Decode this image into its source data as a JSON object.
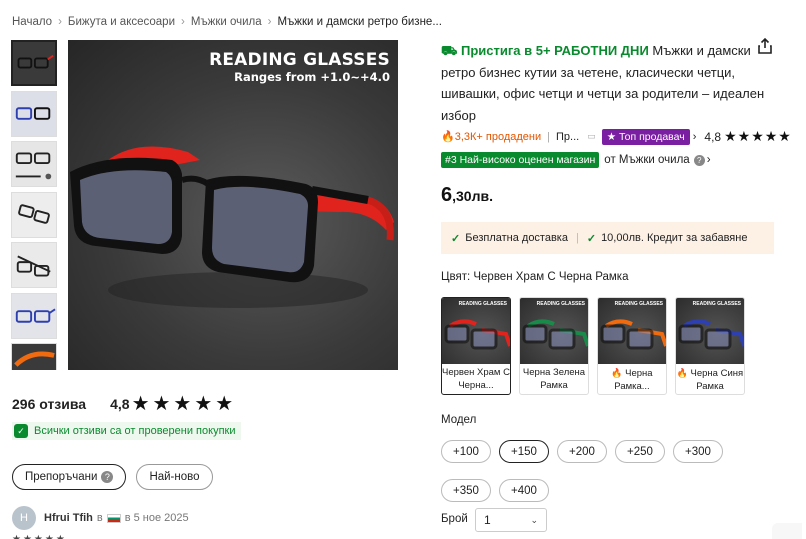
{
  "breadcrumb": [
    "Начало",
    "Бижута и аксесоари",
    "Мъжки очила",
    "Мъжки и дамски ретро бизне..."
  ],
  "hero": {
    "heading": "READING GLASSES",
    "subheading": "Ranges from +1.0~+4.0"
  },
  "reviews": {
    "count_label": "296 отзива",
    "rating": "4,8",
    "stars": "★★★★★",
    "verified_text": "Всички отзиви са от проверени покупки",
    "sort_recommended": "Препоръчани",
    "sort_newest": "Най-ново",
    "first_review": {
      "avatar_letter": "H",
      "name": "Hfrui Tfih",
      "in_word": "в",
      "date_text": "в 5 ное 2025",
      "stars": "★★★★★"
    }
  },
  "product": {
    "shipping_text": "Пристига в 5+ РАБОТНИ ДНИ",
    "title": "Мъжки и дамски ретро бизнес кутии за четене, класически четци, шивашки, офис четци и четци за родители – идеален избор",
    "sold": "3,3К+ продадени",
    "store_short": "Пр...",
    "top_seller": "Топ продавач",
    "rating": "4,8",
    "stars": "★★★★★",
    "rank_badge": "#3 Най-високо оценен магазин",
    "rank_category": "от Мъжки очила",
    "price_whole": "6",
    "price_rest": ",30лв.",
    "benefit_1": "Безплатна доставка",
    "benefit_2": "10,00лв. Кредит за забавяне",
    "color_label": "Цвят: Червен Храм С Черна Рамка",
    "color_options": [
      {
        "label": "Червен Храм С Черна...",
        "hot": false,
        "frame_color": "#111111",
        "temple_color": "#e0231d"
      },
      {
        "label": "Черна Зелена Рамка",
        "hot": false,
        "frame_color": "#111111",
        "temple_color": "#1a8a4a"
      },
      {
        "label": "Черна Рамка...",
        "hot": true,
        "frame_color": "#111111",
        "temple_color": "#f06a10"
      },
      {
        "label": "Черна Синя Рамка",
        "hot": true,
        "frame_color": "#111111",
        "temple_color": "#2e3fb0"
      }
    ],
    "swatch_text": "READING GLASSES",
    "model_label": "Модел",
    "models": [
      "+100",
      "+150",
      "+200",
      "+250",
      "+300",
      "+350",
      "+400"
    ],
    "selected_model": "+150",
    "qty_label": "Брой",
    "qty_value": "1"
  },
  "colors": {
    "accent_green": "#0a8a2e",
    "sold_orange": "#e05500",
    "top_seller_purple": "#7a1fa2",
    "benefit_bg": "#fdf1e6"
  }
}
